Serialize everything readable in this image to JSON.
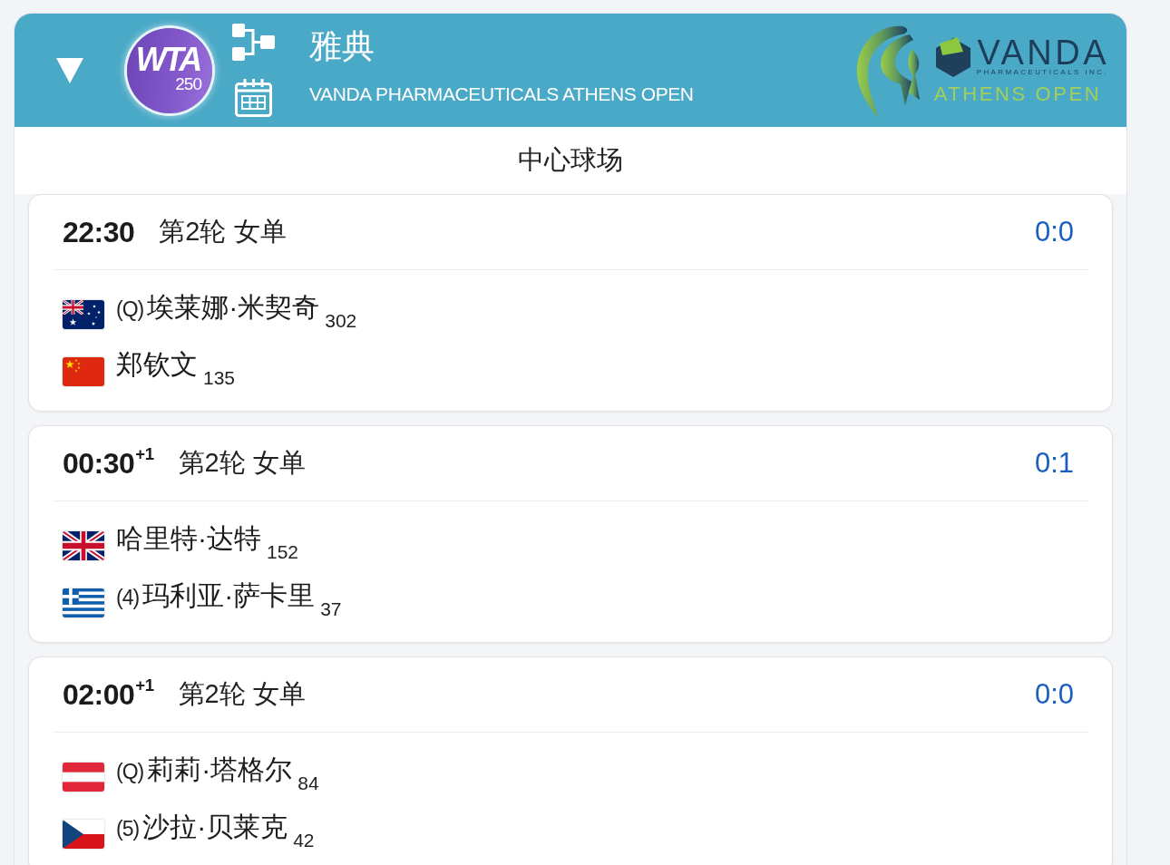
{
  "header": {
    "badge": {
      "brand": "WTA",
      "tier": "250"
    },
    "title": "雅典",
    "subtitle": "VANDA PHARMACEUTICALS ATHENS OPEN",
    "sponsor_logo": {
      "wordmark": "VANDA",
      "tagline": "PHARMACEUTICALS INC.",
      "event": "ATHENS OPEN"
    }
  },
  "court": "中心球场",
  "matches": [
    {
      "time": "22:30",
      "round": "第2轮 女单",
      "score": "0:0",
      "players": [
        {
          "kind": "australia",
          "seed": "(Q)",
          "name": "埃莱娜·米契奇",
          "rank": "302"
        },
        {
          "kind": "china",
          "name": "郑钦文",
          "rank": "135"
        }
      ]
    },
    {
      "time": "00:30$^{+1}$",
      "round": "第2轮 女单",
      "score": "0:1",
      "players": [
        {
          "kind": "uk",
          "name": "哈里特·达特",
          "rank": "152"
        },
        {
          "kind": "greece",
          "seed": "(4)",
          "name": "玛利亚·萨卡里",
          "rank": "37"
        }
      ]
    },
    {
      "time": "02:00$^{+1}$",
      "round": "第2轮 女单",
      "score": "0:0",
      "players": [
        {
          "kind": "austria",
          "seed": "(Q)",
          "name": "莉莉·塔格尔",
          "rank": "84"
        },
        {
          "kind": "czech",
          "seed": "(5)",
          "name": "沙拉·贝莱克",
          "rank": "42"
        }
      ]
    }
  ]
}
